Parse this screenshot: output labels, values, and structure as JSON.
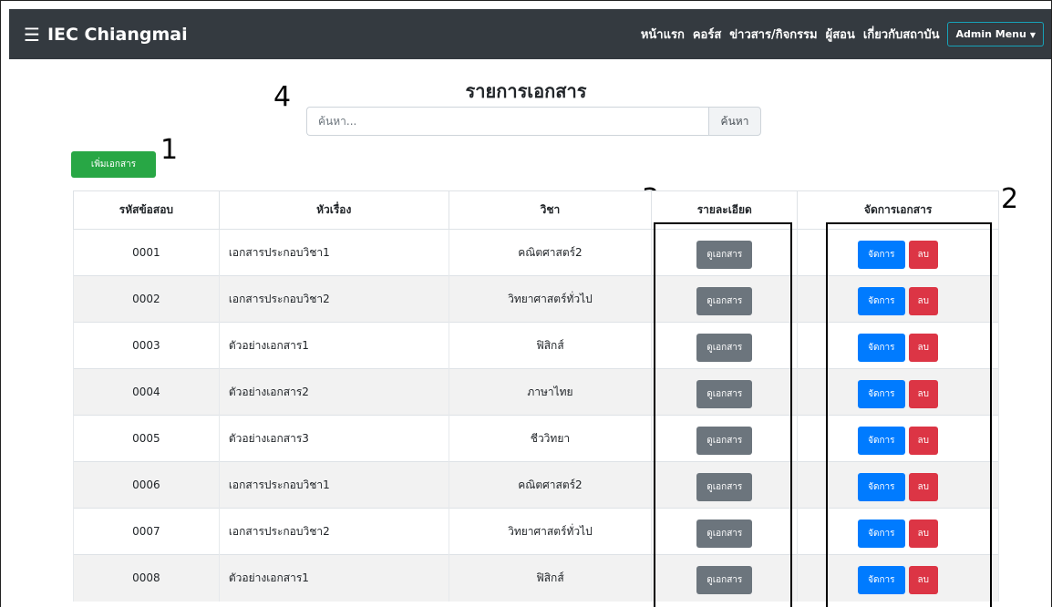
{
  "navbar": {
    "menu_icon": "hamburger-icon",
    "brand": "IEC Chiangmai",
    "links": [
      "หน้าแรก",
      "คอร์ส",
      "ข่าวสาร/กิจกรรม",
      "ผู้สอน",
      "เกี่ยวกับสถาบัน"
    ],
    "admin_menu": "Admin Menu",
    "bg_color": "#343a40"
  },
  "page": {
    "title": "รายการเอกสาร",
    "search_placeholder": "ค้นหา...",
    "search_button": "ค้นหา",
    "add_button": "เพิ่มเอกสาร"
  },
  "annotations": [
    "1",
    "2",
    "3",
    "4"
  ],
  "table": {
    "headers": [
      "รหัสข้อสอบ",
      "หัวเรื่อง",
      "วิชา",
      "รายละเอียด",
      "จัดการเอกสาร"
    ],
    "view_label": "ดูเอกสาร",
    "edit_label": "จัดการ",
    "delete_label": "ลบ",
    "rows": [
      {
        "code": "0001",
        "title": "เอกสารประกอบวิชา1",
        "subject": "คณิตศาสตร์2"
      },
      {
        "code": "0002",
        "title": "เอกสารประกอบวิชา2",
        "subject": "วิทยาศาสตร์ทั่วไป"
      },
      {
        "code": "0003",
        "title": "ตัวอย่างเอกสาร1",
        "subject": "ฟิสิกส์"
      },
      {
        "code": "0004",
        "title": "ตัวอย่างเอกสาร2",
        "subject": "ภาษาไทย"
      },
      {
        "code": "0005",
        "title": "ตัวอย่างเอกสาร3",
        "subject": "ชีววิทยา"
      },
      {
        "code": "0006",
        "title": "เอกสารประกอบวิชา1",
        "subject": "คณิตศาสตร์2"
      },
      {
        "code": "0007",
        "title": "เอกสารประกอบวิชา2",
        "subject": "วิทยาศาสตร์ทั่วไป"
      },
      {
        "code": "0008",
        "title": "ตัวอย่างเอกสาร1",
        "subject": "ฟิสิกส์"
      }
    ]
  },
  "colors": {
    "add": "#28a745",
    "view": "#6c757d",
    "edit": "#007bff",
    "delete": "#dc3545"
  }
}
